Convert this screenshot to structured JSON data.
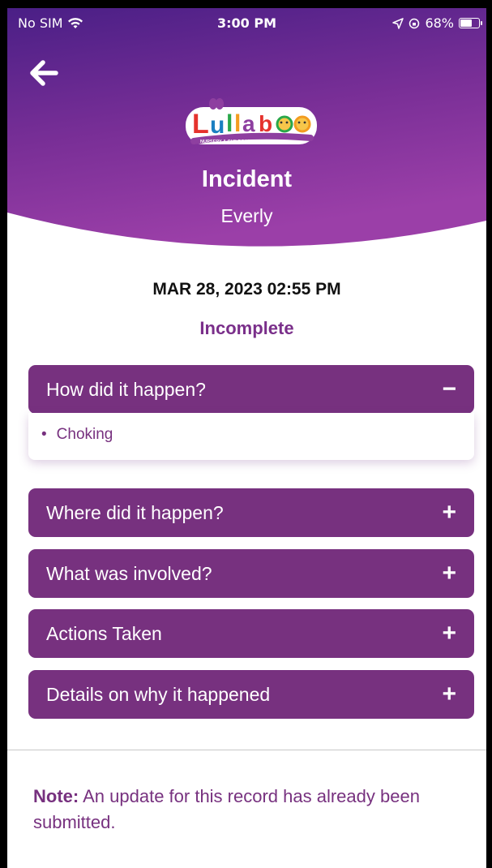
{
  "status_bar": {
    "carrier": "No SIM",
    "time": "3:00 PM",
    "battery": "68%",
    "battery_level": 0.68
  },
  "header": {
    "title": "Incident",
    "child_name": "Everly"
  },
  "logo": {
    "text": "Lullaboo",
    "subtitle": "NURSERY & CHILDCARE CENTER INC."
  },
  "record": {
    "datetime": "MAR 28, 2023 02:55 PM",
    "status": "Incomplete"
  },
  "sections": [
    {
      "title": "How did it happen?",
      "expanded": true,
      "toggle": "−",
      "items": [
        "Choking"
      ]
    },
    {
      "title": "Where did it happen?",
      "expanded": false,
      "toggle": "+"
    },
    {
      "title": "What was involved?",
      "expanded": false,
      "toggle": "+"
    },
    {
      "title": "Actions Taken",
      "expanded": false,
      "toggle": "+"
    },
    {
      "title": "Details on why it happened",
      "expanded": false,
      "toggle": "+"
    }
  ],
  "note": {
    "label": "Note:",
    "text": " An update for this record has already been submitted."
  },
  "colors": {
    "primary": "#77317f",
    "header_top": "#4a1f86",
    "header_bottom": "#9b3fa8"
  }
}
